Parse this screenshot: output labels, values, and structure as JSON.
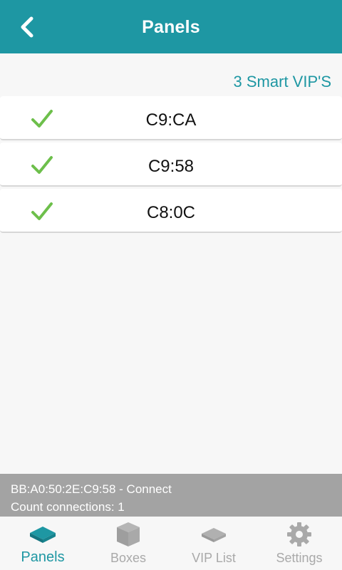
{
  "header": {
    "title": "Panels",
    "back_icon": "chevron-left-icon"
  },
  "panel_count_label": "3 Smart VIP'S",
  "panels": [
    {
      "name": "C9:CA",
      "status_icon": "check-icon"
    },
    {
      "name": "C9:58",
      "status_icon": "check-icon"
    },
    {
      "name": "C8:0C",
      "status_icon": "check-icon"
    }
  ],
  "status": {
    "line1": "BB:A0:50:2E:C9:58 - Connect",
    "line2": "Count connections: 1"
  },
  "nav": [
    {
      "label": "Panels",
      "icon": "panel-icon",
      "active": true
    },
    {
      "label": "Boxes",
      "icon": "box-icon",
      "active": false
    },
    {
      "label": "VIP List",
      "icon": "layers-icon",
      "active": false
    },
    {
      "label": "Settings",
      "icon": "gear-icon",
      "active": false
    }
  ],
  "colors": {
    "accent": "#1e97a3",
    "check": "#6dbf4b",
    "status_bg": "#a3a3a3",
    "inactive": "#a9a9a9"
  }
}
